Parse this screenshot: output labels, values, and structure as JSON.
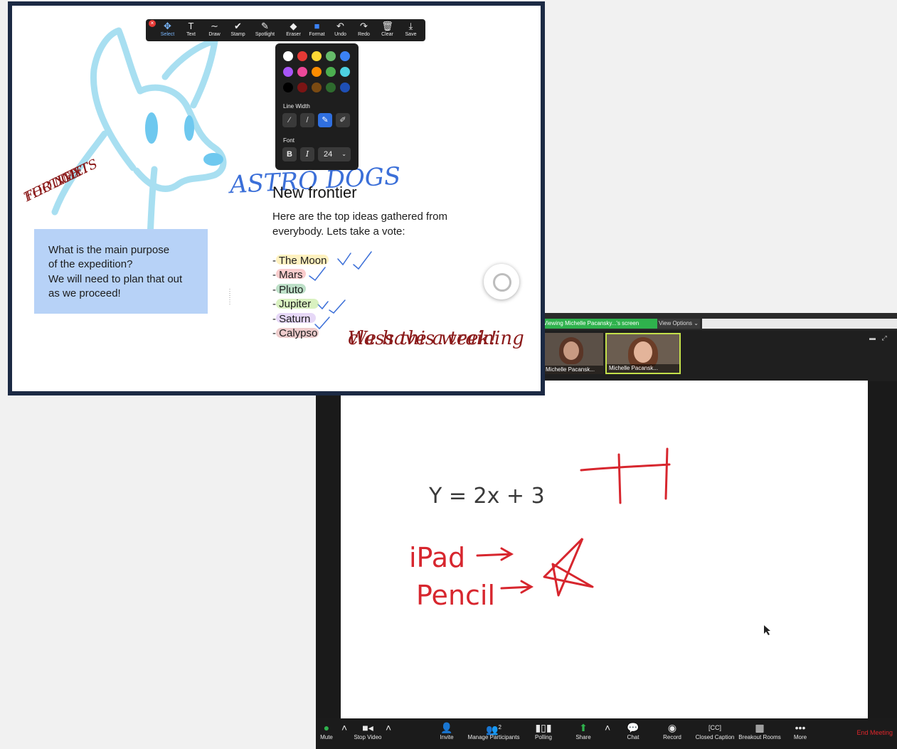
{
  "zoom": {
    "viewing_banner": "Viewing Michelle Pacansky...'s screen",
    "view_options": "View Options",
    "thumbnails": [
      {
        "name": "Michelle Pacansk..."
      },
      {
        "name": "Michelle Pacansk..."
      }
    ],
    "whiteboard": {
      "equation": "Y = 2x + 3",
      "ipad_label": "iPad",
      "pencil_label": "Pencil"
    },
    "toolbar": [
      {
        "label": "Mute",
        "icon": "microphone-icon"
      },
      {
        "label": "Stop Video",
        "icon": "video-camera-icon"
      },
      {
        "label": "Invite",
        "icon": "invite-icon"
      },
      {
        "label": "Manage Participants",
        "icon": "participants-icon",
        "badge": "2"
      },
      {
        "label": "Polling",
        "icon": "polling-icon"
      },
      {
        "label": "Share",
        "icon": "share-icon"
      },
      {
        "label": "Chat",
        "icon": "chat-icon"
      },
      {
        "label": "Record",
        "icon": "record-icon"
      },
      {
        "label": "Closed Caption",
        "icon": "cc-icon"
      },
      {
        "label": "Breakout Rooms",
        "icon": "breakout-rooms-icon"
      },
      {
        "label": "More",
        "icon": "more-icon"
      }
    ],
    "end_meeting": "End Meeting",
    "colors": {
      "share_green": "#2fb24d",
      "end_red": "#e0262b",
      "ink_red": "#d7262e"
    }
  },
  "annotate": {
    "tools": [
      {
        "label": "Select",
        "icon": "select-icon",
        "active": true
      },
      {
        "label": "Text",
        "icon": "text-icon"
      },
      {
        "label": "Draw",
        "icon": "draw-icon"
      },
      {
        "label": "Stamp",
        "icon": "stamp-icon"
      },
      {
        "label": "Spotlight",
        "icon": "spotlight-icon"
      },
      {
        "label": "Eraser",
        "icon": "eraser-icon"
      },
      {
        "label": "Format",
        "icon": "format-icon"
      },
      {
        "label": "Undo",
        "icon": "undo-icon"
      },
      {
        "label": "Redo",
        "icon": "redo-icon"
      },
      {
        "label": "Clear",
        "icon": "trash-icon"
      },
      {
        "label": "Save",
        "icon": "save-icon"
      }
    ],
    "format": {
      "palette": [
        "#ffffff",
        "#e53935",
        "#fdd835",
        "#66bb6a",
        "#3b82f6",
        "#a855f7",
        "#ec4899",
        "#fb8c00",
        "#4caf50",
        "#4dd0e1",
        "#000000",
        "#7b1414",
        "#7a4a12",
        "#2e6b2e",
        "#1e4fb5"
      ],
      "line_width_label": "Line Width",
      "font_label": "Font",
      "bold": "B",
      "italic": "I",
      "font_size": "24"
    }
  },
  "board": {
    "astro_title": "ASTRO DOGS",
    "heading": "New frontier",
    "intro_lines": [
      "Here are the top ideas gathered from",
      "everybody. Lets take a vote:"
    ],
    "items": [
      {
        "text": "- The Moon",
        "highlight": "#fde68a"
      },
      {
        "text": "- Mars",
        "highlight": "#f5a3a3"
      },
      {
        "text": "- Pluto",
        "highlight": "#86c79a"
      },
      {
        "text": "- Jupiter",
        "highlight": "#b9e58c"
      },
      {
        "text": "- Saturn",
        "highlight": "#d2b8f0"
      },
      {
        "text": "- Calypso",
        "highlight": "#e0a3a3"
      }
    ],
    "note_lines": [
      "What is the main purpose",
      "of the expedition?",
      "We will need to plan that out",
      "as we proceed!"
    ],
    "thoughts_lines": [
      "THOUGHTS",
      "FOR NEXT",
      "TIME!"
    ],
    "training_lines": [
      "We have a training",
      "class this week!"
    ],
    "colors": {
      "note_blue": "#b7d2f7",
      "dog_blue": "#9fdcf0",
      "ink_dark_red": "#8b1a1a",
      "ink_blue": "#3b6fd8"
    }
  }
}
